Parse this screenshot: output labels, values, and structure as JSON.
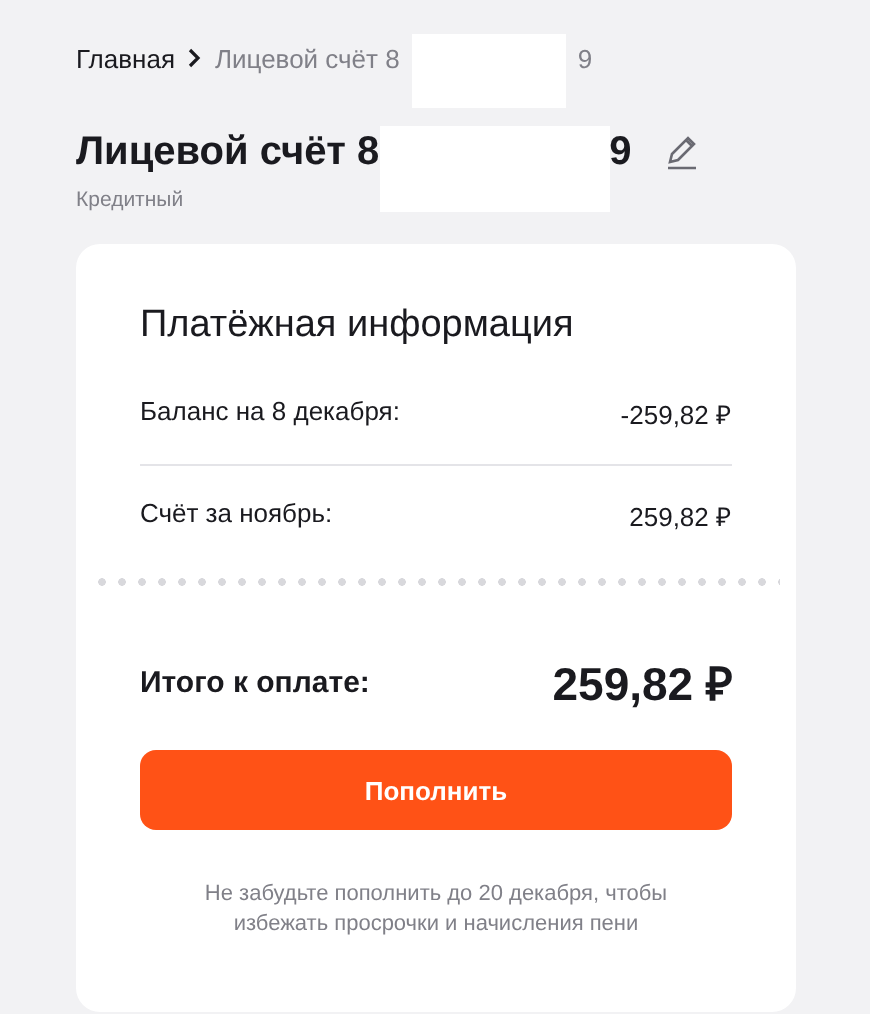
{
  "breadcrumb": [
    {
      "label": "Главная",
      "kind": "link"
    },
    {
      "label": "Лицевой счёт 8",
      "kind": "current",
      "redacted": true,
      "tail": "9"
    }
  ],
  "title": {
    "text": "Лицевой счёт 8",
    "redacted": true,
    "tail": "9"
  },
  "subtitle": "Кредитный",
  "card": {
    "heading": "Платёжная информация",
    "rows": [
      {
        "label": "Баланс на 8 декабря:",
        "value": "-259,82 ₽"
      },
      {
        "label": "Счёт за ноябрь:",
        "value": "259,82 ₽"
      }
    ],
    "total": {
      "label": "Итого к оплате:",
      "value": "259,82 ₽"
    },
    "button": "Пополнить",
    "note": "Не забудьте пополнить до 20 декабря, чтобы избежать просрочки и начисления пени"
  }
}
